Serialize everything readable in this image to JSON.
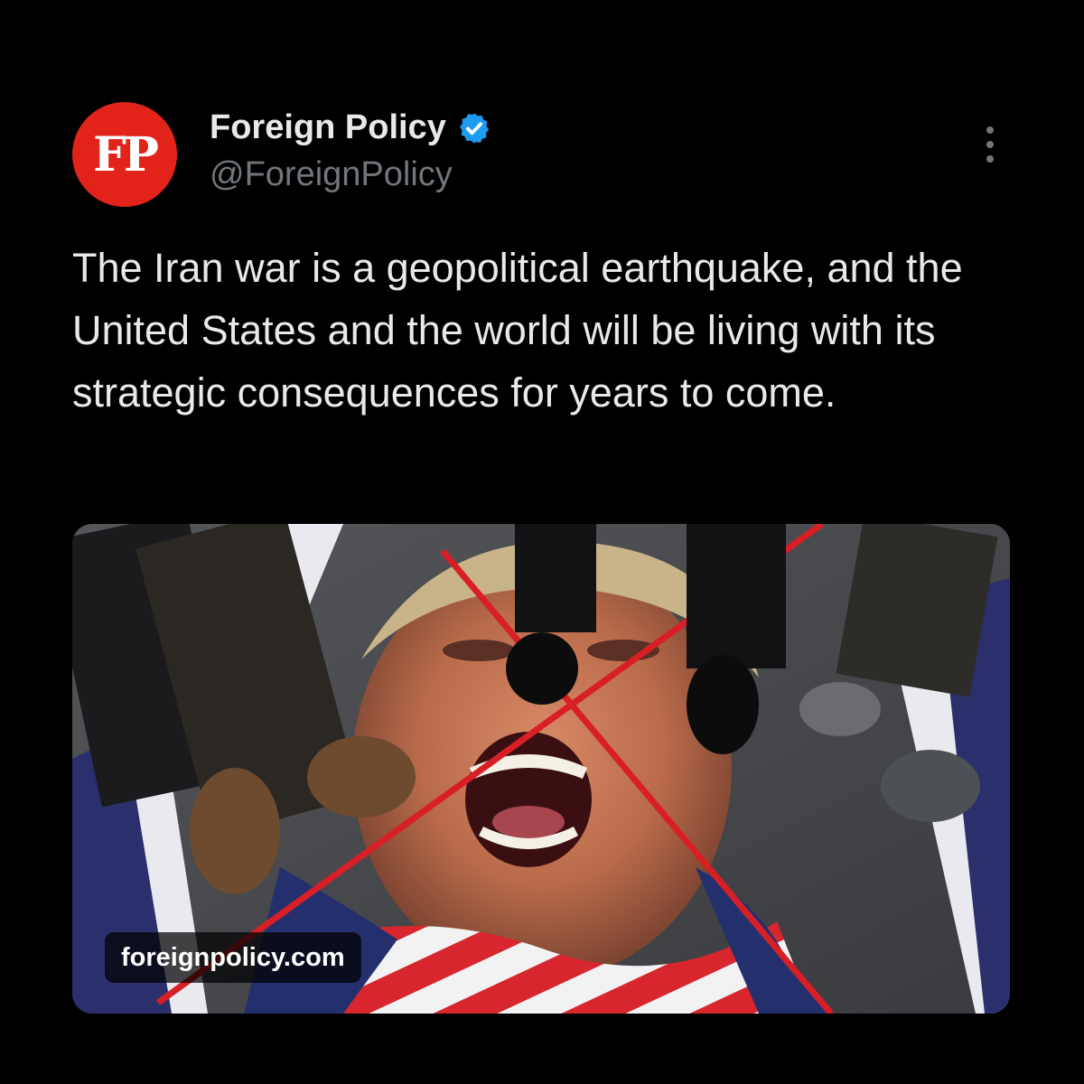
{
  "account": {
    "avatar_text": "FP",
    "display_name": "Foreign Policy",
    "handle": "@ForeignPolicy",
    "verified": true,
    "verified_icon": "verified-badge-icon"
  },
  "tweet": {
    "text": "The Iran war is a geopolitical earthquake, and the United States and the world will be living with its strategic consequences for years to come."
  },
  "media": {
    "domain": "foreignpolicy.com",
    "description_icon": "photo"
  },
  "menu": {
    "icon": "more-vertical-icon"
  },
  "colors": {
    "background": "#000000",
    "text_primary": "#e7e9ea",
    "text_secondary": "#71767b",
    "avatar_bg": "#e2231a",
    "verified": "#1d9bf0"
  }
}
